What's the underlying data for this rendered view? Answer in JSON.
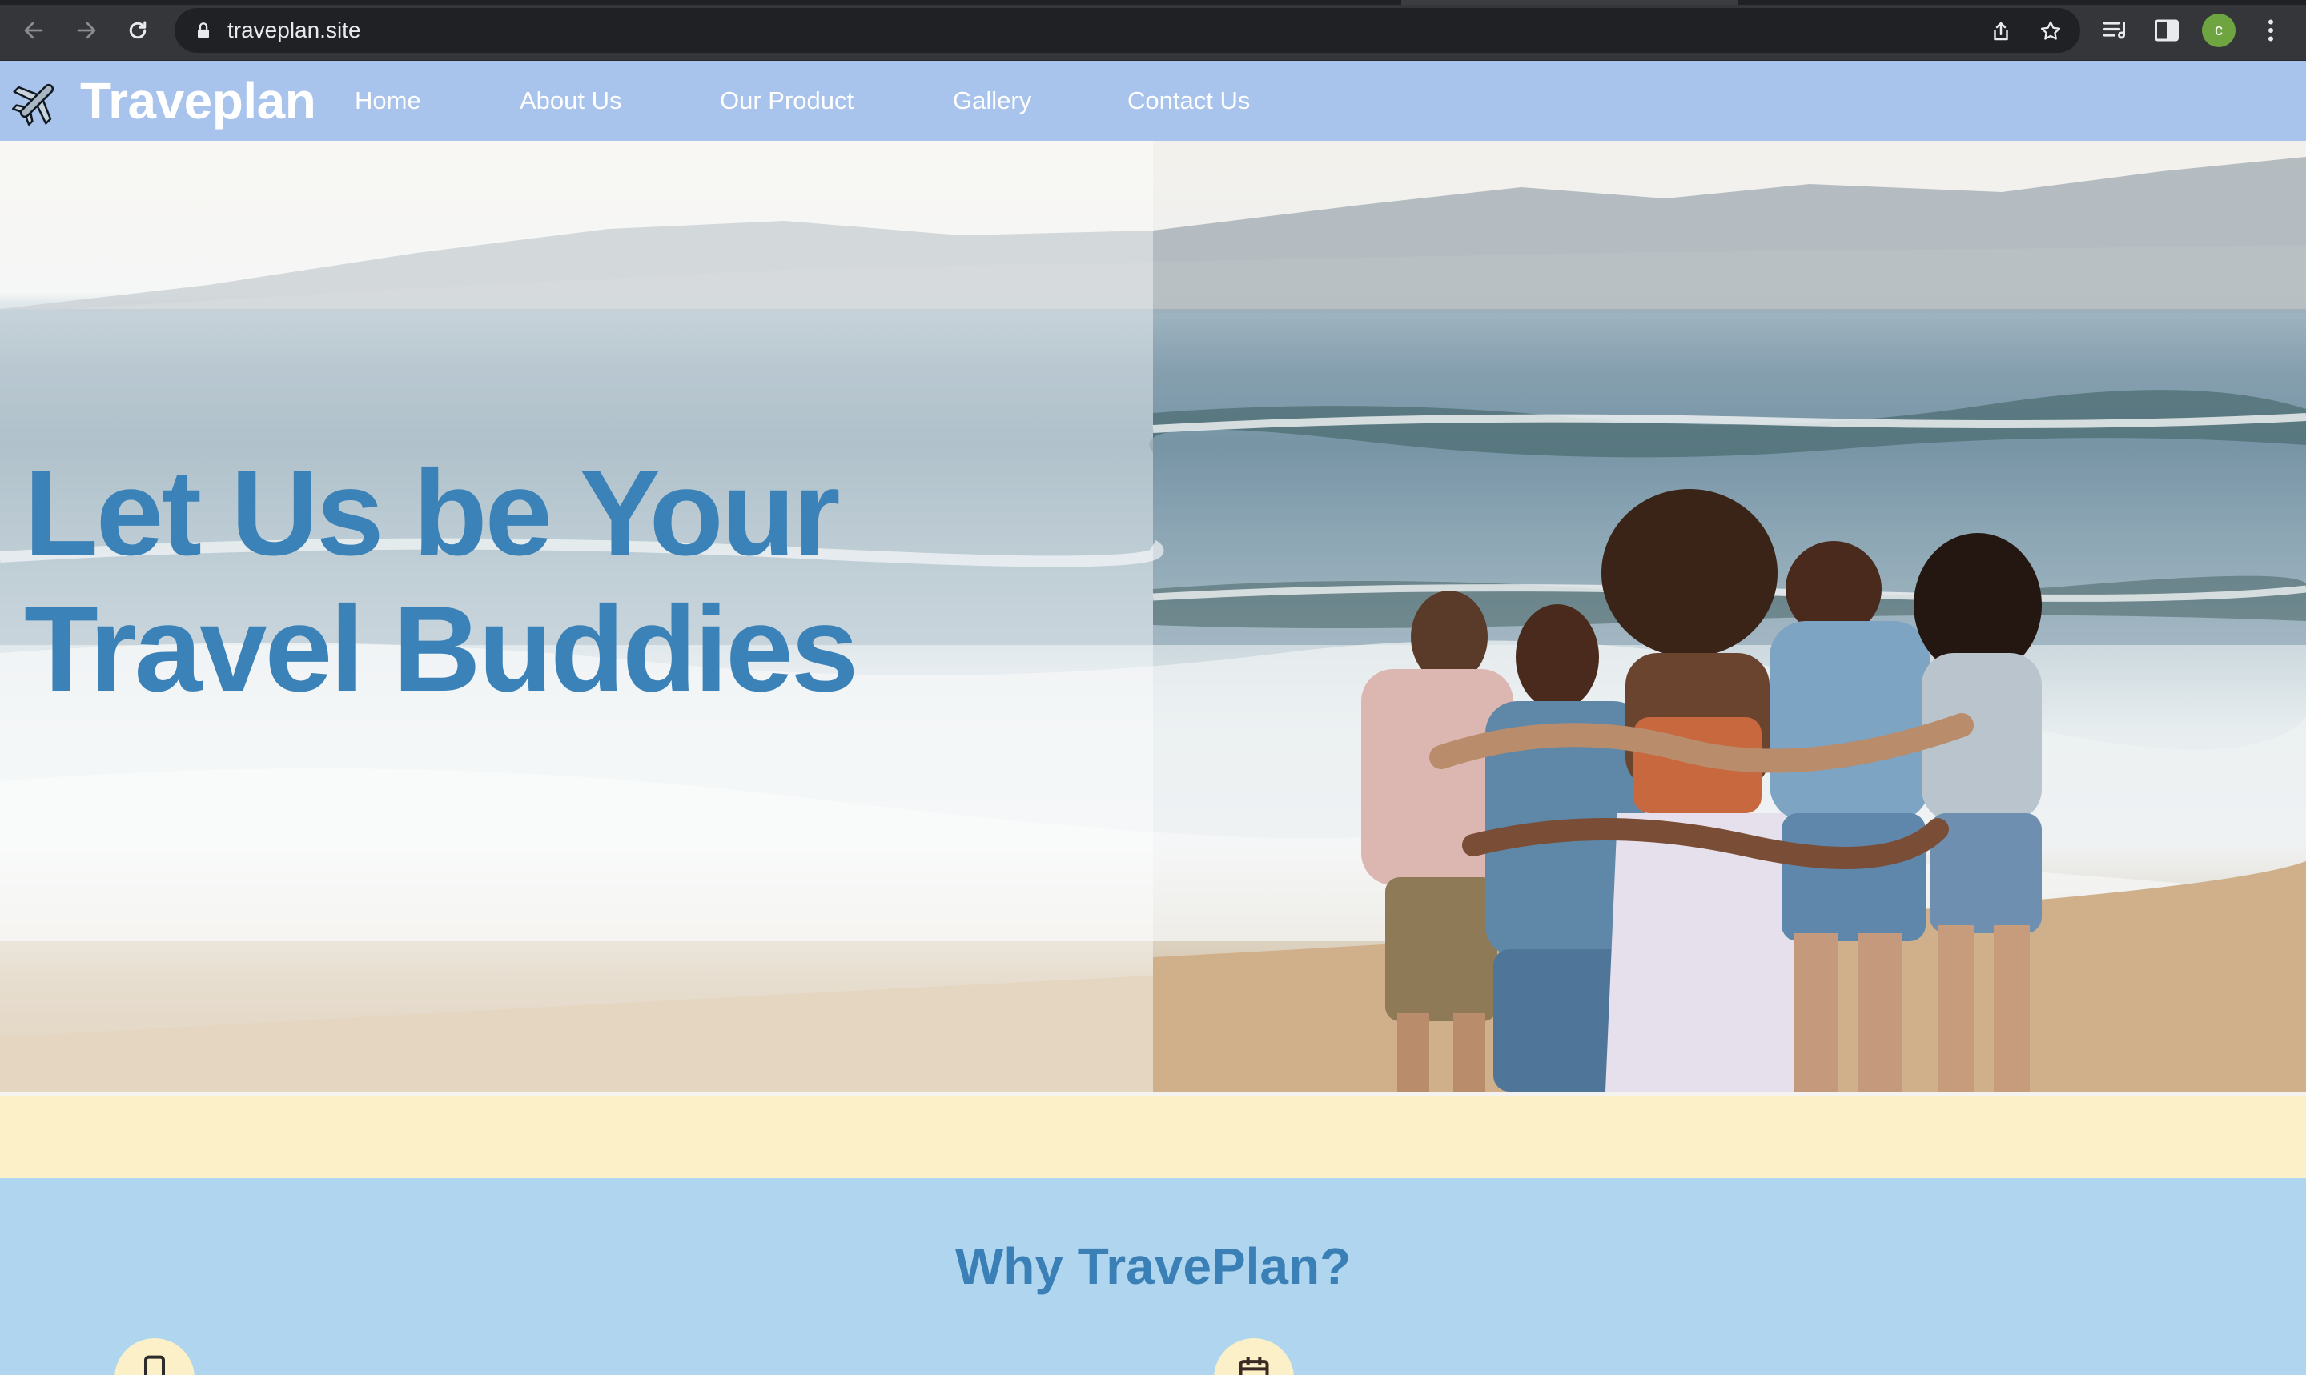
{
  "browser": {
    "url": "traveplan.site",
    "profile_initial": "c",
    "icons": [
      "back-arrow-icon",
      "forward-arrow-icon",
      "reload-icon",
      "lock-icon",
      "share-icon",
      "bookmark-star-icon",
      "reading-list-icon",
      "side-panel-icon",
      "kebab-menu-icon"
    ]
  },
  "site": {
    "brand": "Traveplan",
    "brand_icon": "airplane-icon",
    "nav": [
      "Home",
      "About Us",
      "Our Product",
      "Gallery",
      "Contact Us"
    ]
  },
  "hero": {
    "headline": "Let Us be Your Travel Buddies"
  },
  "why": {
    "title": "Why TravePlan?",
    "feature_icons": [
      "phone-icon",
      "calendar-icon"
    ]
  },
  "colors": {
    "nav_bar": "#a8c3ec",
    "headline": "#3b82b8",
    "cream_band": "#fbf0c8",
    "why_background": "#b0d6ef",
    "why_title": "#3a7fb5"
  }
}
